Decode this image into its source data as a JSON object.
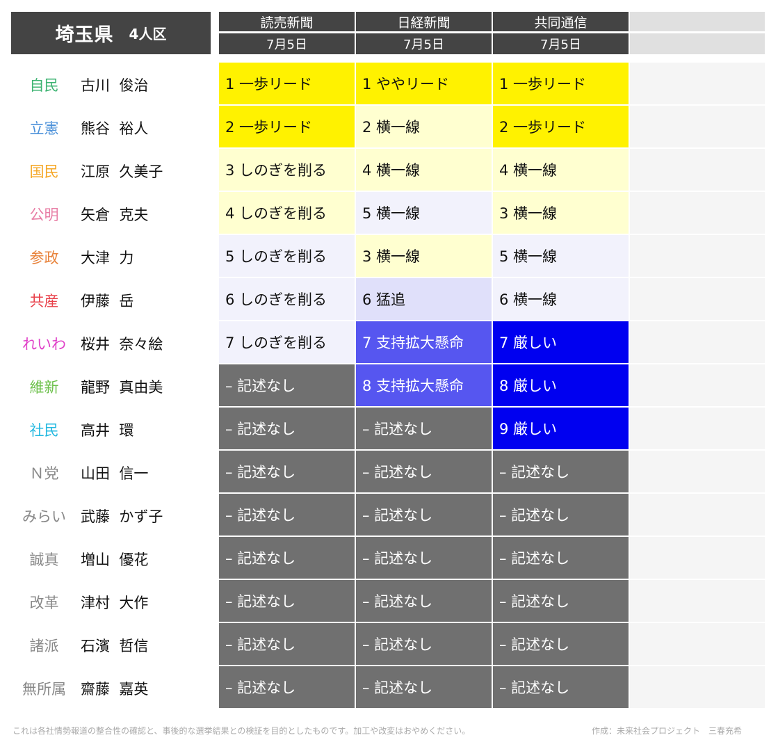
{
  "header": {
    "prefecture": "埼玉県",
    "seats": "4人区"
  },
  "columns": [
    {
      "name": "読売新聞",
      "date": "7月5日"
    },
    {
      "name": "日経新聞",
      "date": "7月5日"
    },
    {
      "name": "共同通信",
      "date": "7月5日"
    },
    {
      "name": "",
      "date": ""
    }
  ],
  "rows": [
    {
      "party": "自民",
      "party_color": "#3cb371",
      "candidate": "古川  俊治",
      "cells": [
        {
          "text": "1 一歩リード",
          "bg": "#fff200",
          "fg": "#111111"
        },
        {
          "text": "1 ややリード",
          "bg": "#fff200",
          "fg": "#111111"
        },
        {
          "text": "1 一歩リード",
          "bg": "#fff200",
          "fg": "#111111"
        }
      ]
    },
    {
      "party": "立憲",
      "party_color": "#4a90d9",
      "candidate": "熊谷  裕人",
      "cells": [
        {
          "text": "2 一歩リード",
          "bg": "#fff200",
          "fg": "#111111"
        },
        {
          "text": "2 横一線",
          "bg": "#ffffd0",
          "fg": "#111111"
        },
        {
          "text": "2 一歩リード",
          "bg": "#fff200",
          "fg": "#111111"
        }
      ]
    },
    {
      "party": "国民",
      "party_color": "#f5a623",
      "candidate": "江原  久美子",
      "cells": [
        {
          "text": "3 しのぎを削る",
          "bg": "#ffffd0",
          "fg": "#111111"
        },
        {
          "text": "4 横一線",
          "bg": "#ffffd0",
          "fg": "#111111"
        },
        {
          "text": "4 横一線",
          "bg": "#ffffd0",
          "fg": "#111111"
        }
      ]
    },
    {
      "party": "公明",
      "party_color": "#e87fa6",
      "candidate": "矢倉  克夫",
      "cells": [
        {
          "text": "4 しのぎを削る",
          "bg": "#ffffd0",
          "fg": "#111111"
        },
        {
          "text": "5 横一線",
          "bg": "#f2f2fc",
          "fg": "#111111"
        },
        {
          "text": "3 横一線",
          "bg": "#ffffd0",
          "fg": "#111111"
        }
      ]
    },
    {
      "party": "参政",
      "party_color": "#e8823a",
      "candidate": "大津  力",
      "cells": [
        {
          "text": "5 しのぎを削る",
          "bg": "#f2f2fc",
          "fg": "#111111"
        },
        {
          "text": "3 横一線",
          "bg": "#ffffd0",
          "fg": "#111111"
        },
        {
          "text": "5 横一線",
          "bg": "#f2f2fc",
          "fg": "#111111"
        }
      ]
    },
    {
      "party": "共産",
      "party_color": "#e8404a",
      "candidate": "伊藤  岳",
      "cells": [
        {
          "text": "6 しのぎを削る",
          "bg": "#f2f2fc",
          "fg": "#111111"
        },
        {
          "text": "6 猛追",
          "bg": "#e0e0fa",
          "fg": "#111111"
        },
        {
          "text": "6 横一線",
          "bg": "#f2f2fc",
          "fg": "#111111"
        }
      ]
    },
    {
      "party": "れいわ",
      "party_color": "#e040c8",
      "candidate": "桜井  奈々絵",
      "cells": [
        {
          "text": "7 しのぎを削る",
          "bg": "#f2f2fc",
          "fg": "#111111"
        },
        {
          "text": "7 支持拡大懸命",
          "bg": "#5656f0",
          "fg": "#ffffff"
        },
        {
          "text": "7 厳しい",
          "bg": "#0000f0",
          "fg": "#ffffff"
        }
      ]
    },
    {
      "party": "維新",
      "party_color": "#6cc04a",
      "candidate": "龍野  真由美",
      "cells": [
        {
          "text": "– 記述なし",
          "bg": "#707070",
          "fg": "#ffffff"
        },
        {
          "text": "8 支持拡大懸命",
          "bg": "#5656f0",
          "fg": "#ffffff"
        },
        {
          "text": "8 厳しい",
          "bg": "#0000f0",
          "fg": "#ffffff"
        }
      ]
    },
    {
      "party": "社民",
      "party_color": "#22b8e0",
      "candidate": "高井  環",
      "cells": [
        {
          "text": "– 記述なし",
          "bg": "#707070",
          "fg": "#ffffff"
        },
        {
          "text": "– 記述なし",
          "bg": "#707070",
          "fg": "#ffffff"
        },
        {
          "text": "9 厳しい",
          "bg": "#0000f0",
          "fg": "#ffffff"
        }
      ]
    },
    {
      "party": "Ｎ党",
      "party_color": "#888888",
      "candidate": "山田  信一",
      "cells": [
        {
          "text": "– 記述なし",
          "bg": "#707070",
          "fg": "#ffffff"
        },
        {
          "text": "– 記述なし",
          "bg": "#707070",
          "fg": "#ffffff"
        },
        {
          "text": "– 記述なし",
          "bg": "#707070",
          "fg": "#ffffff"
        }
      ]
    },
    {
      "party": "みらい",
      "party_color": "#888888",
      "candidate": "武藤  かず子",
      "cells": [
        {
          "text": "– 記述なし",
          "bg": "#707070",
          "fg": "#ffffff"
        },
        {
          "text": "– 記述なし",
          "bg": "#707070",
          "fg": "#ffffff"
        },
        {
          "text": "– 記述なし",
          "bg": "#707070",
          "fg": "#ffffff"
        }
      ]
    },
    {
      "party": "誠真",
      "party_color": "#888888",
      "candidate": "増山  優花",
      "cells": [
        {
          "text": "– 記述なし",
          "bg": "#707070",
          "fg": "#ffffff"
        },
        {
          "text": "– 記述なし",
          "bg": "#707070",
          "fg": "#ffffff"
        },
        {
          "text": "– 記述なし",
          "bg": "#707070",
          "fg": "#ffffff"
        }
      ]
    },
    {
      "party": "改革",
      "party_color": "#888888",
      "candidate": "津村  大作",
      "cells": [
        {
          "text": "– 記述なし",
          "bg": "#707070",
          "fg": "#ffffff"
        },
        {
          "text": "– 記述なし",
          "bg": "#707070",
          "fg": "#ffffff"
        },
        {
          "text": "– 記述なし",
          "bg": "#707070",
          "fg": "#ffffff"
        }
      ]
    },
    {
      "party": "諸派",
      "party_color": "#888888",
      "candidate": "石濱  哲信",
      "cells": [
        {
          "text": "– 記述なし",
          "bg": "#707070",
          "fg": "#ffffff"
        },
        {
          "text": "– 記述なし",
          "bg": "#707070",
          "fg": "#ffffff"
        },
        {
          "text": "– 記述なし",
          "bg": "#707070",
          "fg": "#ffffff"
        }
      ]
    },
    {
      "party": "無所属",
      "party_color": "#888888",
      "candidate": "齋藤  嘉英",
      "cells": [
        {
          "text": "– 記述なし",
          "bg": "#707070",
          "fg": "#ffffff"
        },
        {
          "text": "– 記述なし",
          "bg": "#707070",
          "fg": "#ffffff"
        },
        {
          "text": "– 記述なし",
          "bg": "#707070",
          "fg": "#ffffff"
        }
      ]
    }
  ],
  "footer": {
    "note": "これは各社情勢報道の整合性の確認と、事後的な選挙結果との検証を目的としたものです。加工や改変はおやめください。",
    "credit": "作成：未来社会プロジェクト　三春充希"
  }
}
